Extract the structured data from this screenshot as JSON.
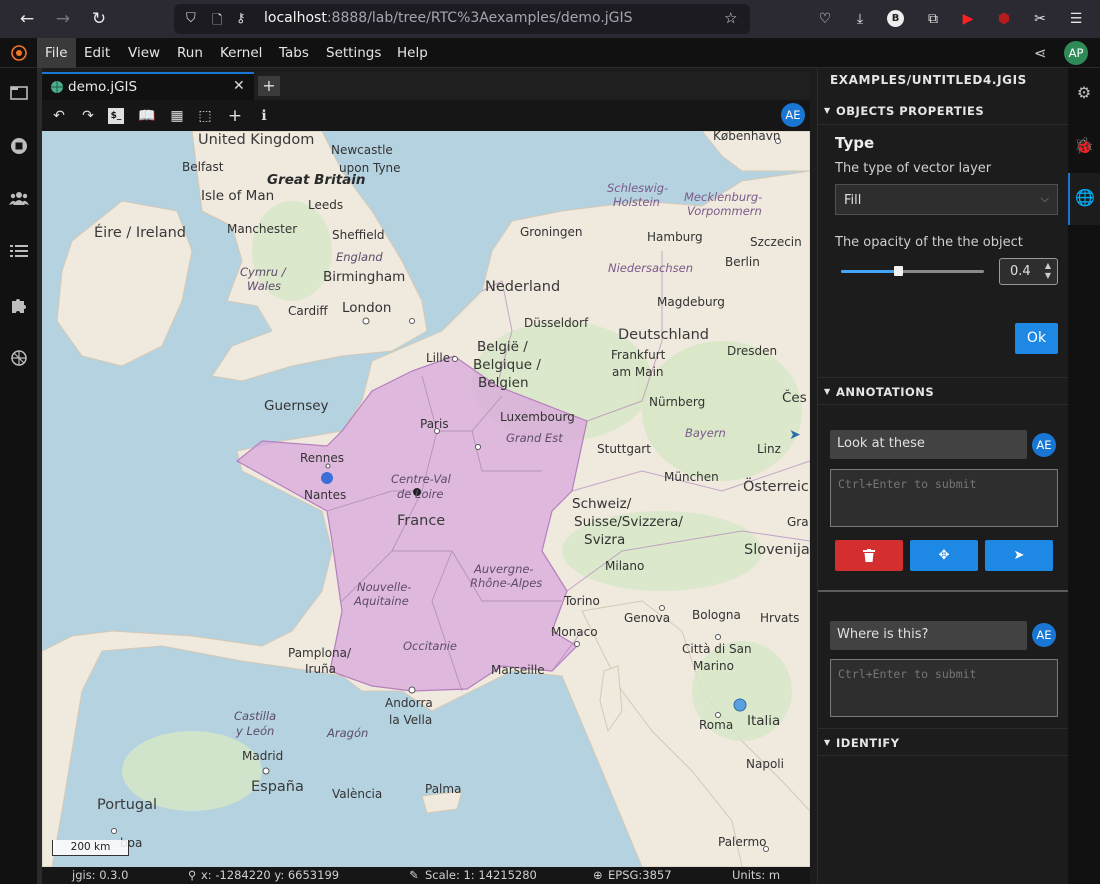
{
  "browser": {
    "url_host": "localhost",
    "url_rest": ":8888/lab/tree/RTC%3Aexamples/demo.jGIS"
  },
  "menubar": {
    "items": [
      "File",
      "Edit",
      "View",
      "Run",
      "Kernel",
      "Tabs",
      "Settings",
      "Help"
    ],
    "user_initials": "AP"
  },
  "document": {
    "tab_label": "demo.jGIS",
    "add_tab": "+",
    "collaborator_initials": "AE"
  },
  "map": {
    "scale_bar": "200 km",
    "labels": {
      "uk": "United Kingdom",
      "newcastle": "Newcastle",
      "upon_tyne": "upon Tyne",
      "belfast": "Belfast",
      "great_britain": "Great Britain",
      "isle_of_man": "Isle of Man",
      "leeds": "Leeds",
      "eire": "Éire / Ireland",
      "manchester": "Manchester",
      "sheffield": "Sheffield",
      "england": "England",
      "cymru": "Cymru /",
      "wales": "Wales",
      "birmingham": "Birmingham",
      "cardiff": "Cardiff",
      "london": "London",
      "kobenhavn": "København",
      "schleswig": "Schleswig-",
      "holstein": "Holstein",
      "mecklenburg": "Mecklenburg-",
      "vorpommern": "Vorpommern",
      "groningen": "Groningen",
      "hamburg": "Hamburg",
      "szczecin": "Szczecin",
      "berlin": "Berlin",
      "niedersachsen": "Niedersachsen",
      "nederland": "Nederland",
      "magdeburg": "Magdeburg",
      "dusseldorf": "Düsseldorf",
      "deutschland": "Deutschland",
      "lille": "Lille",
      "belgie": "België /",
      "belgique": "Belgique /",
      "belgien": "Belgien",
      "frankfurt": "Frankfurt",
      "am_main": "am Main",
      "dresden": "Dresden",
      "ces": "Čes",
      "guernsey": "Guernsey",
      "luxembourg": "Luxembourg",
      "nurnberg": "Nürnberg",
      "paris": "Paris",
      "grand_est": "Grand Est",
      "bayern": "Bayern",
      "stuttgart": "Stuttgart",
      "linz": "Linz",
      "rennes": "Rennes",
      "centre": "Centre-Val",
      "de_loire": "de Loire",
      "munchen": "München",
      "osterreich": "Österreic",
      "nantes": "Nantes",
      "schweiz": "Schweiz/",
      "suisse": "Suisse/Svizzera/",
      "svizra": "Svizra",
      "france": "France",
      "gra": "Gra",
      "slovenija": "Slovenija",
      "auvergne": "Auvergne-",
      "rhone_alpes": "Rhône-Alpes",
      "milano": "Milano",
      "nouvelle": "Nouvelle-",
      "aquitaine": "Aquitaine",
      "torino": "Torino",
      "genova": "Genova",
      "bologna": "Bologna",
      "hrvats": "Hrvats",
      "pamplona": "Pamplona/",
      "iruna": "Iruña",
      "occitanie": "Occitanie",
      "monaco": "Monaco",
      "citta": "Città di San",
      "marino": "Marino",
      "marseille": "Marseille",
      "andorra": "Andorra",
      "la_vella": "la Vella",
      "castilla": "Castilla",
      "y_leon": "y León",
      "aragon": "Aragón",
      "italia": "Italia",
      "roma": "Roma",
      "madrid": "Madrid",
      "espana": "España",
      "valencia": "València",
      "napoli": "Napoli",
      "palma": "Palma",
      "portugal": "Portugal",
      "lisboa": "boa",
      "palermo": "Palermo"
    },
    "fill_color": "#d9a3dd",
    "fill_opacity": 0.4
  },
  "statusbar": {
    "version": "jgis: 0.3.0",
    "coords": "x: -1284220 y: 6653199",
    "scale": "Scale: 1: 14215280",
    "epsg": "EPSG:3857",
    "units": "Units: m"
  },
  "panel": {
    "file_title": "EXAMPLES/UNTITLED4.JGIS",
    "objects_properties": {
      "title": "OBJECTS PROPERTIES",
      "type_heading": "Type",
      "type_desc": "The type of vector layer",
      "type_value": "Fill",
      "opacity_desc": "The opacity of the the object",
      "opacity_value": "0.4",
      "opacity_fraction": 0.4,
      "ok": "Ok"
    },
    "annotations": {
      "title": "ANNOTATIONS",
      "threads": [
        {
          "message": "Look at these",
          "author": "AE",
          "placeholder": "Ctrl+Enter to submit"
        },
        {
          "message": "Where is this?",
          "author": "AE",
          "placeholder": "Ctrl+Enter to submit"
        }
      ],
      "colors": {
        "delete": "#d32f2f",
        "locate": "#1e88e5",
        "submit": "#1e88e5"
      }
    },
    "identify": {
      "title": "IDENTIFY"
    }
  }
}
